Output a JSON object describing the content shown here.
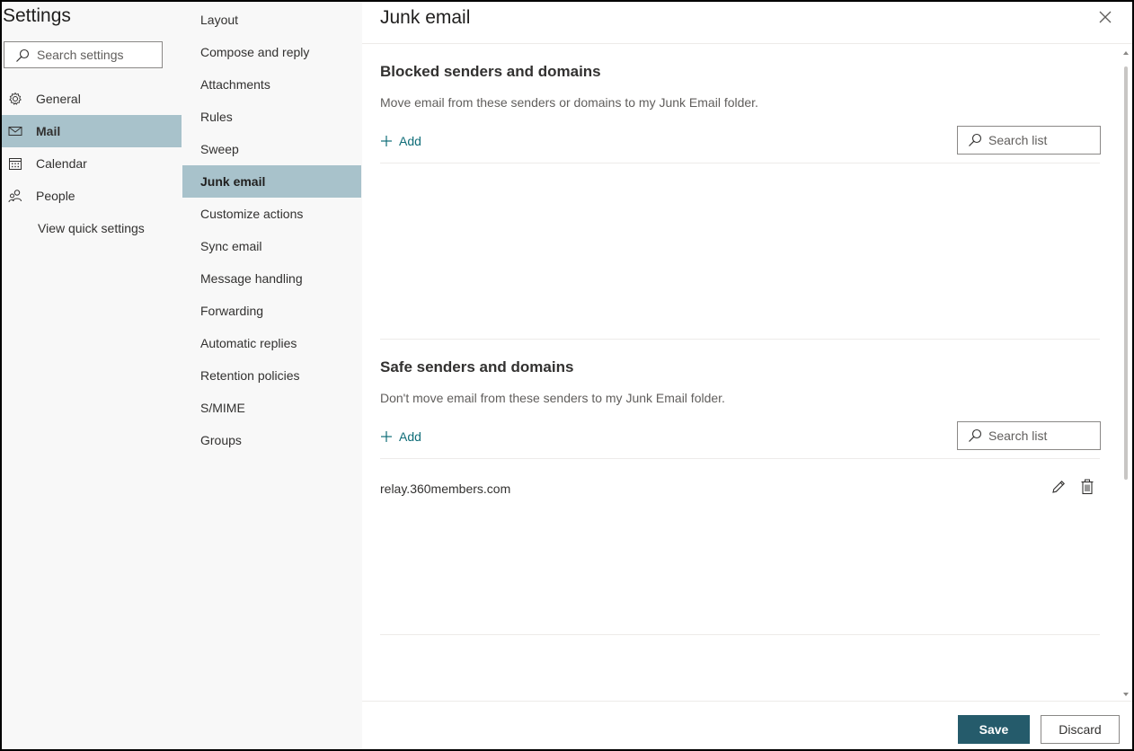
{
  "nav": {
    "title": "Settings",
    "search_placeholder": "Search settings",
    "items": [
      {
        "label": "General",
        "icon": "gear-icon"
      },
      {
        "label": "Mail",
        "icon": "envelope-icon",
        "selected": true
      },
      {
        "label": "Calendar",
        "icon": "calendar-icon"
      },
      {
        "label": "People",
        "icon": "people-icon"
      }
    ],
    "quick_settings_label": "View quick settings"
  },
  "subnav": {
    "items": [
      {
        "label": "Layout"
      },
      {
        "label": "Compose and reply"
      },
      {
        "label": "Attachments"
      },
      {
        "label": "Rules"
      },
      {
        "label": "Sweep"
      },
      {
        "label": "Junk email",
        "selected": true
      },
      {
        "label": "Customize actions"
      },
      {
        "label": "Sync email"
      },
      {
        "label": "Message handling"
      },
      {
        "label": "Forwarding"
      },
      {
        "label": "Automatic replies"
      },
      {
        "label": "Retention policies"
      },
      {
        "label": "S/MIME"
      },
      {
        "label": "Groups"
      }
    ]
  },
  "pane": {
    "title": "Junk email",
    "blocked": {
      "title": "Blocked senders and domains",
      "description": "Move email from these senders or domains to my Junk Email folder.",
      "add_label": "Add",
      "search_placeholder": "Search list",
      "entries": []
    },
    "safe": {
      "title": "Safe senders and domains",
      "description": "Don't move email from these senders to my Junk Email folder.",
      "add_label": "Add",
      "search_placeholder": "Search list",
      "entries": [
        "relay.360members.com"
      ]
    }
  },
  "footer": {
    "save_label": "Save",
    "discard_label": "Discard"
  },
  "colors": {
    "accent": "#255b6b",
    "link": "#0f6d78",
    "selected_bg": "#a8c2cb"
  }
}
